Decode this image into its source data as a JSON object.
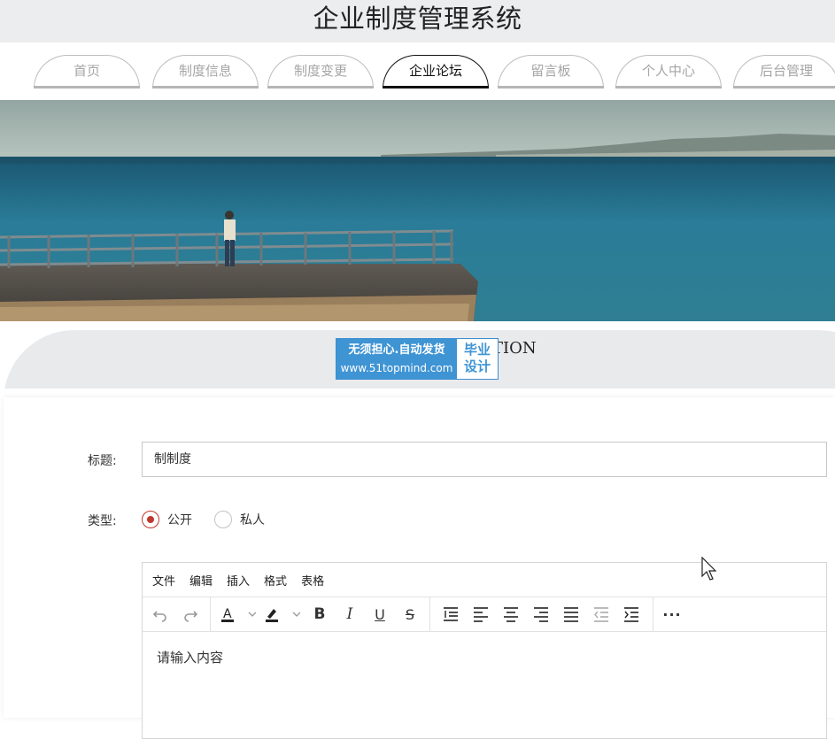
{
  "app_title": "企业制度管理系统",
  "nav": {
    "tabs": [
      {
        "label": "首页",
        "active": false
      },
      {
        "label": "制度信息",
        "active": false
      },
      {
        "label": "制度变更",
        "active": false
      },
      {
        "label": "企业论坛",
        "active": true
      },
      {
        "label": "留言板",
        "active": false
      },
      {
        "label": "个人中心",
        "active": false
      },
      {
        "label": "后台管理",
        "active": false
      }
    ]
  },
  "banner": {
    "subtitle_fragment": "TION",
    "watermark": {
      "line1": "无须担心.自动发货",
      "line2": "www.51topmind.com",
      "right_line1": "毕业",
      "right_line2": "设计"
    }
  },
  "form": {
    "title_label": "标题:",
    "title_value": "制制度",
    "type_label": "类型:",
    "type_options": [
      {
        "label": "公开",
        "checked": true
      },
      {
        "label": "私人",
        "checked": false
      }
    ],
    "editor": {
      "menu": [
        "文件",
        "编辑",
        "插入",
        "格式",
        "表格"
      ],
      "placeholder": "请输入内容",
      "toolbar_icons": [
        "undo-icon",
        "redo-icon",
        "text-color-icon",
        "highlight-color-icon",
        "bold-icon",
        "italic-icon",
        "underline-icon",
        "strikethrough-icon",
        "line-height-icon",
        "align-left-icon",
        "align-center-icon",
        "align-right-icon",
        "align-justify-icon",
        "outdent-icon",
        "indent-icon",
        "more-icon"
      ]
    }
  },
  "colors": {
    "accent": "#c0392b",
    "watermark_blue": "#3f94d4",
    "header_bg": "#ecedef"
  }
}
